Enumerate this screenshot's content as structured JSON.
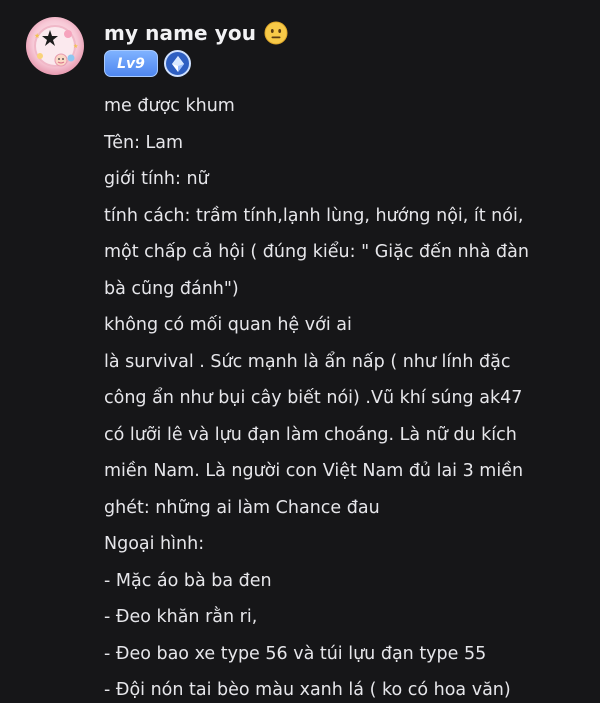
{
  "post": {
    "author": {
      "name": "my name you",
      "name_emoji": "neutral-face-emoji",
      "level_badge": "Lv9",
      "secondary_badge_icon": "gem-icon",
      "avatar": "avatar-image"
    },
    "lines": [
      "me được khum",
      "Tên: Lam",
      "giới tính: nữ",
      "tính cách: trầm tính,lạnh lùng, hướng nội, ít nói,",
      "một chấp cả hội ( đúng kiểu: \" Giặc đến nhà đàn",
      "bà cũng đánh\")",
      "không có mối quan hệ với ai",
      "là survival . Sức mạnh là ẩn nấp ( như lính đặc",
      "công ẩn như bụi cây biết nói) .Vũ khí súng ak47",
      "có lưỡi lê và lựu đạn làm choáng. Là nữ du kích",
      "miền Nam. Là người con Việt Nam đủ lai 3 miền",
      "ghét: những ai làm Chance đau",
      "Ngoại hình:",
      "- Mặc áo bà ba đen",
      "- Đeo khăn rằn ri,",
      "- Đeo bao xe type 56 và túi lựu đạn type 55",
      "-  Đội nón tai bèo màu xanh lá ( ko có hoa văn)"
    ]
  },
  "colors": {
    "background": "#161618",
    "text": "#e6e6ea",
    "level_badge": "#5b93f4",
    "gem_badge": "#2e5fc2"
  }
}
